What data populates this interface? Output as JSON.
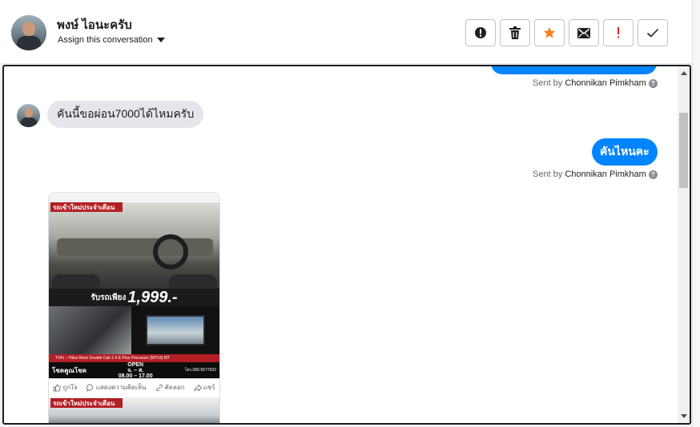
{
  "header": {
    "contact_name": "พงษ์ ไอนะครับ",
    "assign_label": "Assign this conversation",
    "actions": [
      {
        "name": "alert-button",
        "icon": "alert-circle-icon"
      },
      {
        "name": "delete-button",
        "icon": "trash-icon"
      },
      {
        "name": "star-button",
        "icon": "star-icon",
        "color": "#f58220"
      },
      {
        "name": "email-button",
        "icon": "envelope-icon"
      },
      {
        "name": "important-button",
        "icon": "exclamation-icon",
        "color": "#e02020"
      },
      {
        "name": "done-button",
        "icon": "check-icon"
      }
    ]
  },
  "messages": {
    "sent_prefix": "Sent by",
    "agent_name": "Chonnikan Pimkham",
    "help_glyph": "?",
    "incoming_text": "คันนี้ขอผ่อน7000ได้ไหมครับ",
    "outgoing_text": "คันไหนคะ"
  },
  "shared_post": {
    "banner": "รถเข้าใหม่ประจำเดือน",
    "price_prefix": "รับรถเพียง",
    "price": "1,999.-",
    "model_line": "T041 – Hilux Revo Double Cab 2.4 E Plus Prerunner (MY18) MT",
    "dealer_name": "โชคคูณโชค",
    "open_label": "OPEN",
    "open_days": "จ. – ส.",
    "open_hours": "08.00 – 17.00",
    "phone": "โทร.095-5577932",
    "reactions": {
      "like": "ถูกใจ",
      "comment": "แสดงความคิดเห็น",
      "copy": "คัดลอก",
      "share": "แชร์"
    },
    "second_banner": "รถเข้าใหม่ประจำเดือน"
  },
  "colors": {
    "outgoing_bubble": "#0084ff",
    "incoming_bubble": "#e4e6eb",
    "banner_red": "#b41f24"
  }
}
